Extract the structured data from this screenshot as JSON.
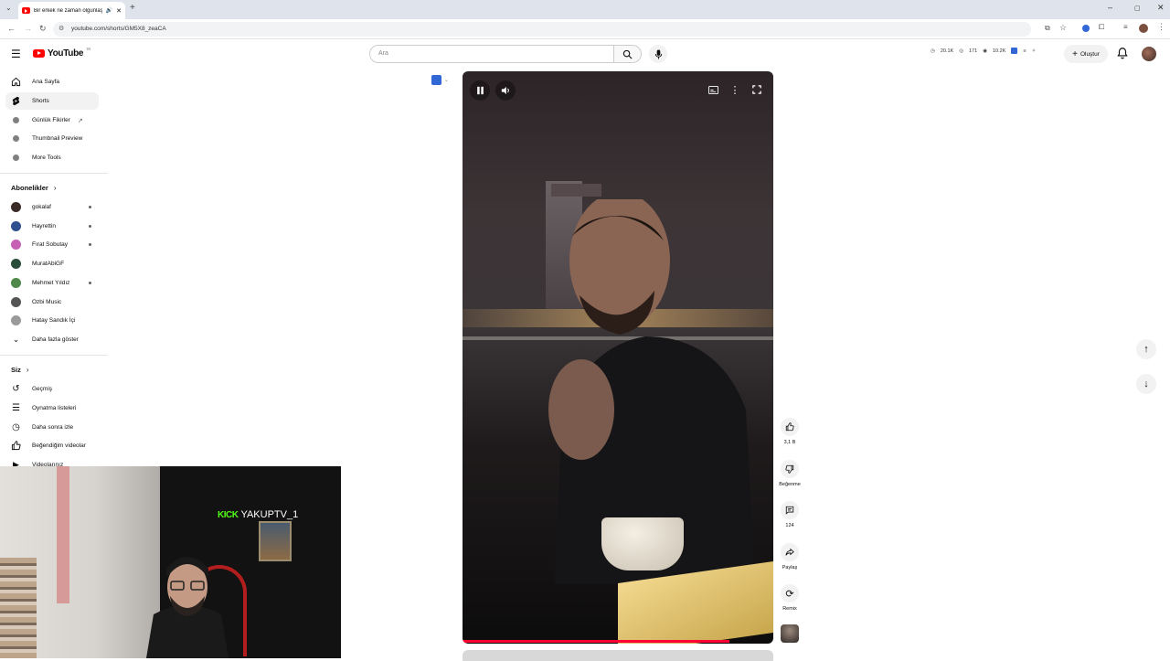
{
  "browser": {
    "tab_title": "Bir erkek ne zaman olgunlaşır",
    "url": "youtube.com/shorts/GM5X8_zeaCA"
  },
  "header": {
    "logo_text": "YouTube",
    "logo_region": "TR",
    "search_placeholder": "Ara",
    "stats": [
      "20.1K",
      "171",
      "10.2K"
    ],
    "create_label": "Oluştur"
  },
  "sidebar": {
    "main": [
      {
        "label": "Ana Sayfa",
        "icon": "home-icon"
      },
      {
        "label": "Shorts",
        "icon": "shorts-icon"
      },
      {
        "label": "Günlük Fikirler",
        "icon": "extension-icon"
      },
      {
        "label": "Thumbnail Preview",
        "icon": "extension-icon"
      },
      {
        "label": "More Tools",
        "icon": "extension-icon"
      }
    ],
    "subscriptions_title": "Abonelikler",
    "subscriptions": [
      {
        "label": "gokalaf",
        "color": "#3a2b26",
        "dot": true
      },
      {
        "label": "Hayrettin",
        "color": "#2f4f8f",
        "dot": true
      },
      {
        "label": "Fırat Sobutay",
        "color": "#c75fb5",
        "dot": true
      },
      {
        "label": "MuratAbiGF",
        "color": "#2a4d3a",
        "dot": false
      },
      {
        "label": "Mehmet Yıldız",
        "color": "#4f8a4a",
        "dot": true
      },
      {
        "label": "Ozbi Music",
        "color": "#555555",
        "dot": false
      },
      {
        "label": "Hatay Sandık İçi",
        "color": "#9a9a9a",
        "dot": false
      }
    ],
    "show_more": "Daha fazla göster",
    "you_title": "Siz",
    "you": [
      {
        "label": "Geçmiş",
        "icon": "history-icon"
      },
      {
        "label": "Oynatma listeleri",
        "icon": "playlist-icon"
      },
      {
        "label": "Daha sonra izle",
        "icon": "clock-icon"
      },
      {
        "label": "Beğendiğim videolar",
        "icon": "thumbs-up-icon"
      },
      {
        "label": "Videolarınız",
        "icon": "video-icon"
      }
    ]
  },
  "actions": {
    "likes": "3,1 B",
    "dislike_label": "Beğenme",
    "comments": "124",
    "share_label": "Paylaş",
    "remix_label": "Remix"
  },
  "video": {
    "progress": 0.86
  },
  "overlay": {
    "kick_brand": "KICK",
    "streamer_name": "YAKUPTV_1"
  },
  "colors": {
    "yt_red": "#ff0000",
    "kick_green": "#53fc18",
    "progress_red": "#ff0033"
  }
}
